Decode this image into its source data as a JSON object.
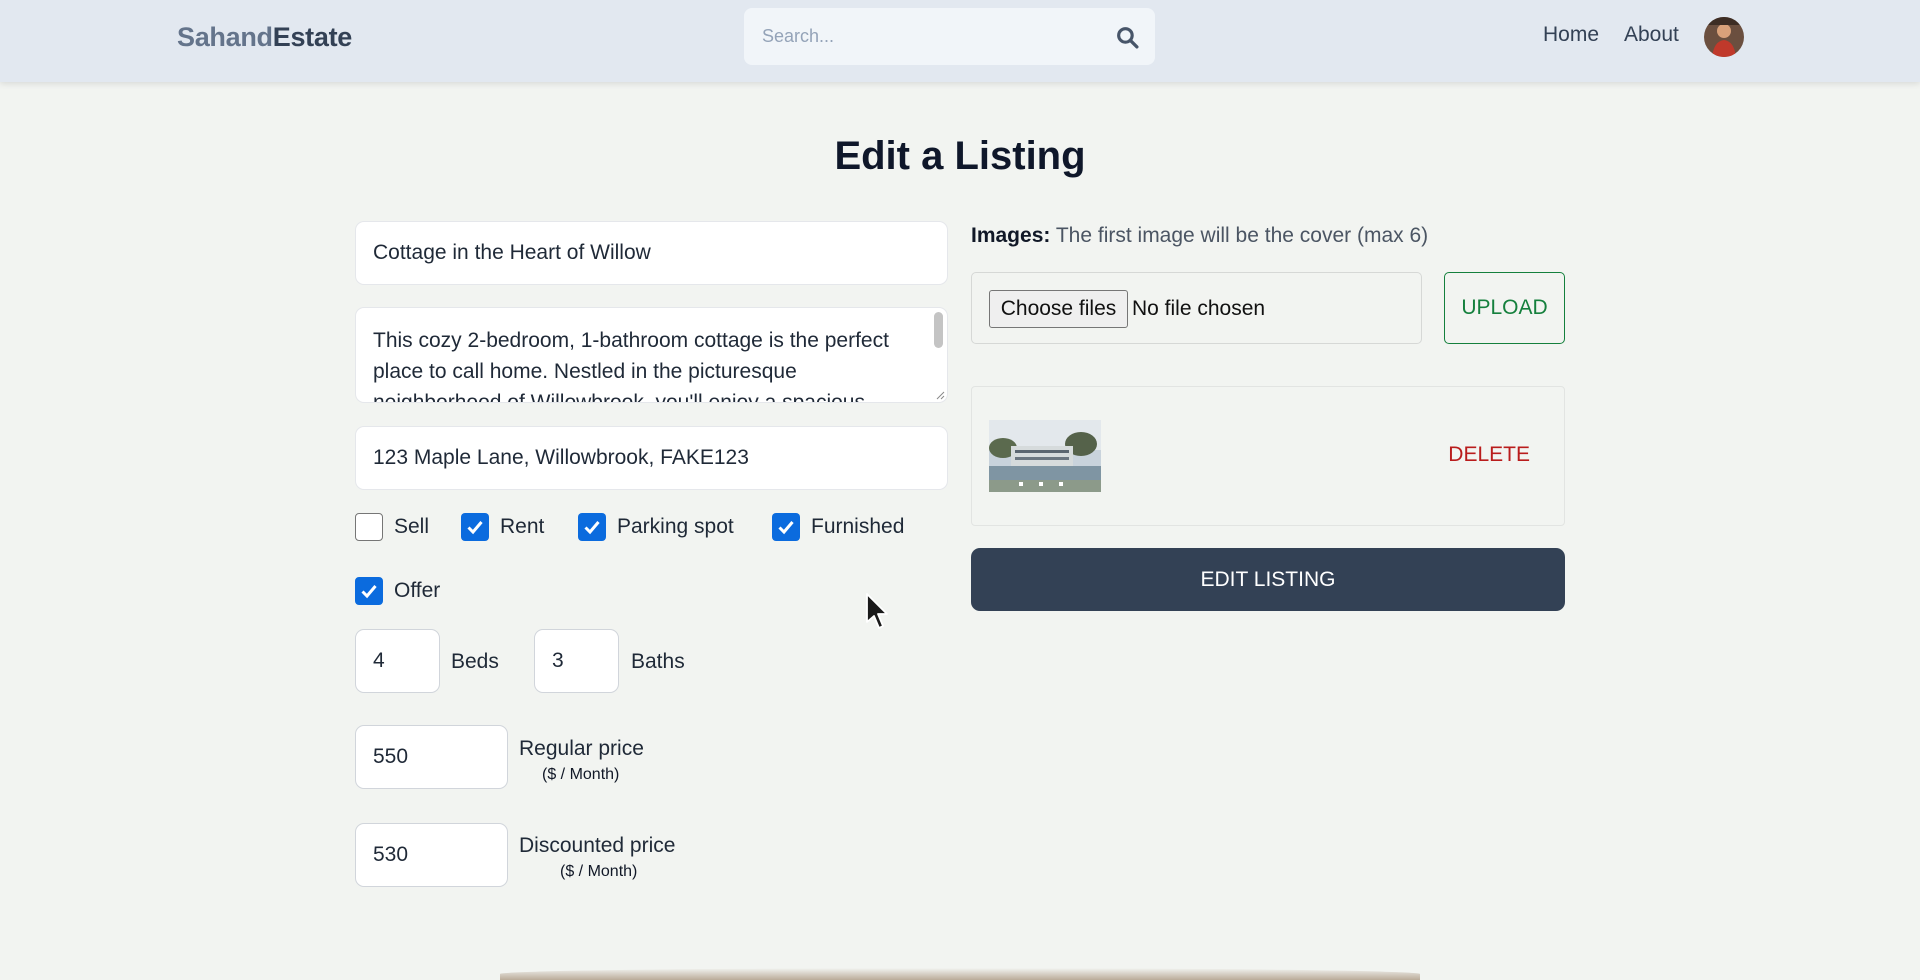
{
  "header": {
    "logo_part1": "Sahand",
    "logo_part2": "Estate",
    "search_placeholder": "Search...",
    "nav": {
      "home": "Home",
      "about": "About"
    }
  },
  "page": {
    "title": "Edit a Listing"
  },
  "form": {
    "name": "Cottage in the Heart of Willow",
    "description": "This cozy 2-bedroom, 1-bathroom cottage is the perfect place to call home. Nestled in the picturesque neighborhood of Willowbrook, you'll enjoy a spacious",
    "address": "123 Maple Lane, Willowbrook, FAKE123",
    "checkboxes": {
      "sell": {
        "label": "Sell",
        "checked": false
      },
      "rent": {
        "label": "Rent",
        "checked": true
      },
      "parking": {
        "label": "Parking spot",
        "checked": true
      },
      "furnished": {
        "label": "Furnished",
        "checked": true
      },
      "offer": {
        "label": "Offer",
        "checked": true
      }
    },
    "beds": {
      "value": "4",
      "label": "Beds"
    },
    "baths": {
      "value": "3",
      "label": "Baths"
    },
    "regular_price": {
      "value": "550",
      "label": "Regular price",
      "unit": "($ / Month)"
    },
    "discounted_price": {
      "value": "530",
      "label": "Discounted price",
      "unit": "($ / Month)"
    }
  },
  "images": {
    "label_bold": "Images:",
    "label_rest": "The first image will be the cover (max 6)",
    "choose_label": "Choose files",
    "no_file": "No file chosen",
    "upload_label": "UPLOAD",
    "delete_label": "DELETE"
  },
  "submit": {
    "label": "EDIT LISTING"
  },
  "colors": {
    "accent_blue": "#0b6bde",
    "upload_green": "#15803d",
    "delete_red": "#b91c1c",
    "button_dark": "#334155"
  }
}
